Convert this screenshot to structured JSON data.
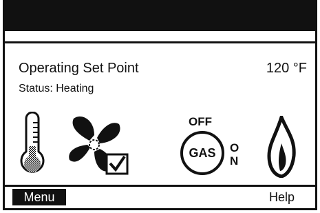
{
  "main": {
    "setpoint_label": "Operating Set Point",
    "setpoint_value": "120 °F",
    "status": "Status: Heating"
  },
  "icons": {
    "thermometer": "thermometer-icon",
    "fan": "fan-icon",
    "gas_valve": "gas-valve-icon",
    "flame": "flame-icon",
    "gas_off_label": "OFF",
    "gas_center_label": "GAS",
    "gas_on_label": "ON",
    "fan_checked": true
  },
  "softkeys": {
    "left_label": "Menu",
    "right_label": "Help"
  },
  "colors": {
    "foreground": "#111111",
    "background": "#ffffff"
  }
}
